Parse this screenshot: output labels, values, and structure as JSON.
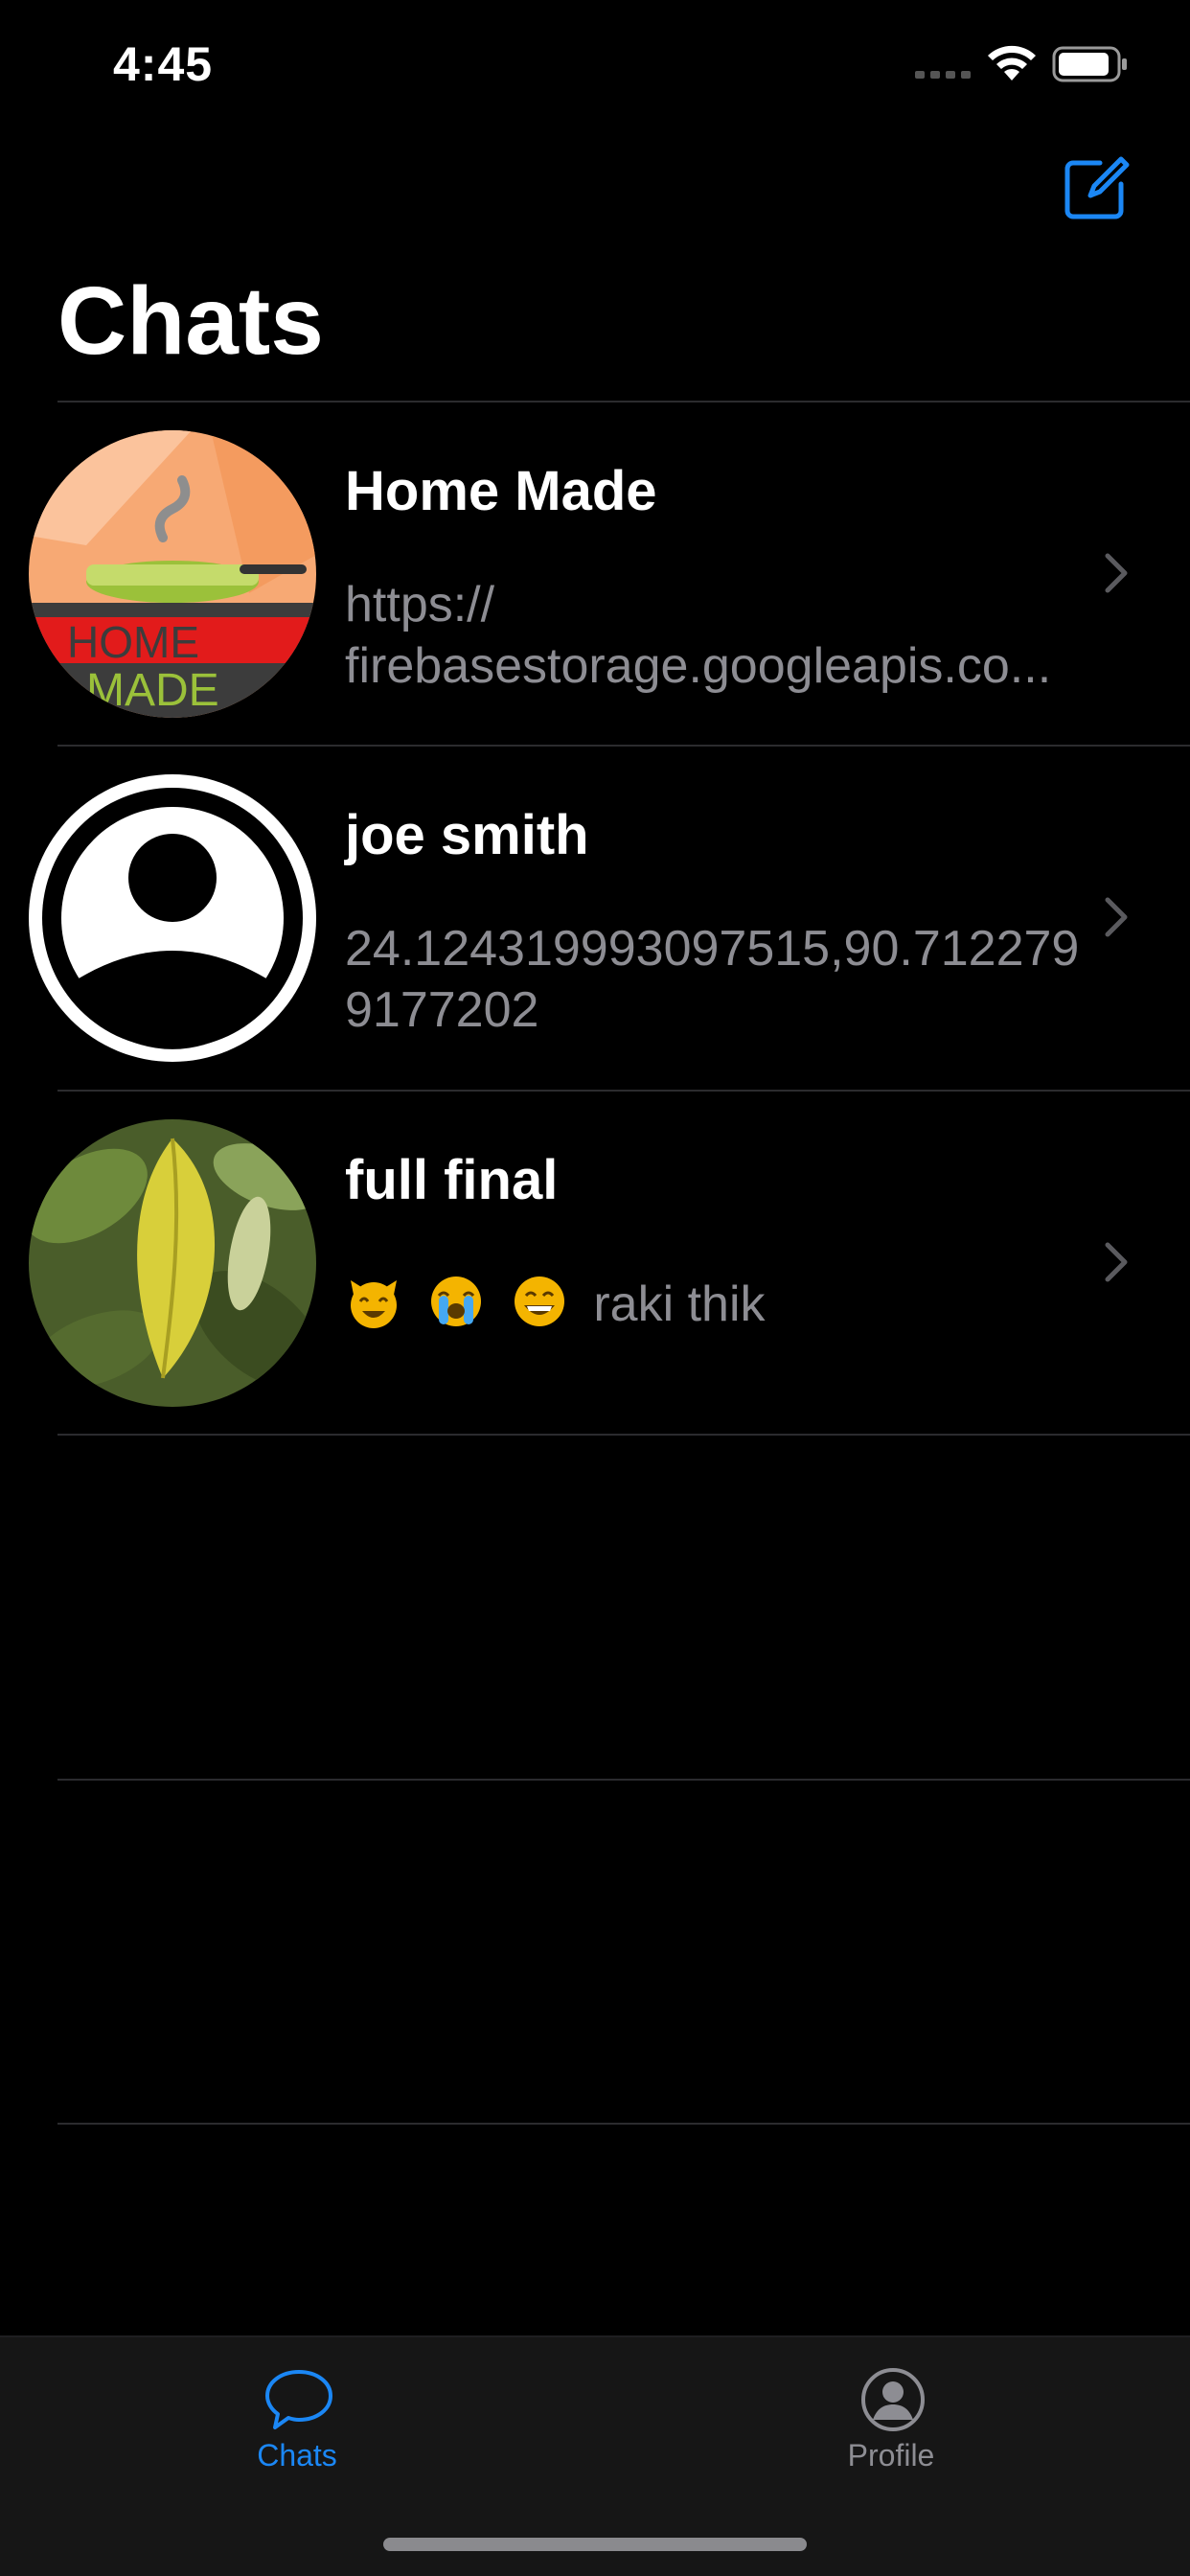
{
  "status_bar": {
    "time": "4:45"
  },
  "nav": {
    "title": "Chats",
    "compose_icon": "compose-icon"
  },
  "chats": [
    {
      "name": "Home Made",
      "preview": "https://\nfirebasestorage.googleapis.co...",
      "avatar": "home-made-logo"
    },
    {
      "name": "joe smith",
      "preview": "24.124319993097515,90.7122799177202",
      "avatar": "default-person-avatar"
    },
    {
      "name": "full final",
      "preview_emojis": [
        "smiling-cat-emoji",
        "crying-face-emoji",
        "grinning-face-emoji"
      ],
      "preview": "raki thik",
      "avatar": "leaf-photo"
    }
  ],
  "tab_bar": {
    "tabs": [
      {
        "label": "Chats",
        "icon": "chat-bubble-icon",
        "active": true
      },
      {
        "label": "Profile",
        "icon": "person-circle-icon",
        "active": false
      }
    ]
  },
  "colors": {
    "accent": "#1b87f5",
    "background": "#000000",
    "secondary_text": "#8d8d93",
    "separator": "#2b2b2e",
    "tab_bar": "#161616"
  }
}
